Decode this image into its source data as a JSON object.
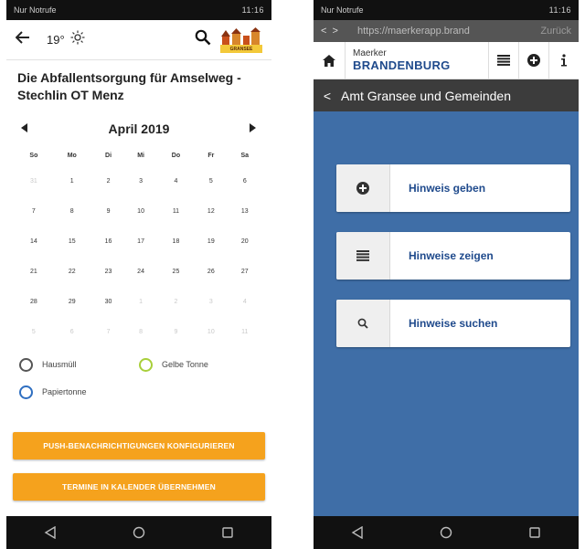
{
  "phone1": {
    "status": {
      "carrier": "Nur Notrufe",
      "right": "11:16"
    },
    "topbar": {
      "temperature": "19°",
      "icons": [
        "back-arrow-icon",
        "sun-icon",
        "search-icon",
        "logo-icon"
      ]
    },
    "logo_text": "GRANSEE",
    "heading": "Die Abfallentsorgung für Amselweg - Stechlin OT Menz",
    "calendar": {
      "month": "April 2019",
      "weekdays": [
        "So",
        "Mo",
        "Di",
        "Mi",
        "Do",
        "Fr",
        "Sa"
      ],
      "weeks": [
        [
          "31",
          "1",
          "2",
          "3",
          "4",
          "5",
          "6"
        ],
        [
          "7",
          "8",
          "9",
          "10",
          "11",
          "12",
          "13"
        ],
        [
          "14",
          "15",
          "16",
          "17",
          "18",
          "19",
          "20"
        ],
        [
          "21",
          "22",
          "23",
          "24",
          "25",
          "26",
          "27"
        ],
        [
          "28",
          "29",
          "30",
          "1",
          "2",
          "3",
          "4"
        ],
        [
          "5",
          "6",
          "7",
          "8",
          "9",
          "10",
          "11"
        ]
      ]
    },
    "legend": [
      {
        "label": "Hausmüll",
        "color": "#555555"
      },
      {
        "label": "Gelbe Tonne",
        "color": "#a8cf3a"
      },
      {
        "label": "Papiertonne",
        "color": "#2f6fc1"
      }
    ],
    "buttons": {
      "push": "PUSH-BENACHRICHTIGUNGEN KONFIGURIEREN",
      "calendar": "TERMINE IN KALENDER ÜBERNEHMEN"
    },
    "accent_color": "#f5a21d"
  },
  "phone2": {
    "status": {
      "carrier": "Nur Notrufe",
      "right": "11:16"
    },
    "urlbar": {
      "url": "https://maerkerapp.brand",
      "back_label": "Zurück"
    },
    "brand": {
      "line1": "Maerker",
      "line2": "BRANDENBURG"
    },
    "title": "Amt Gransee und Gemeinden",
    "menu": [
      {
        "label": "Hinweis geben",
        "icon": "plus-circle-icon"
      },
      {
        "label": "Hinweise zeigen",
        "icon": "list-icon"
      },
      {
        "label": "Hinweise suchen",
        "icon": "search-icon"
      }
    ],
    "background_color": "#3f6ea7",
    "brand_color": "#1f4a8c"
  }
}
